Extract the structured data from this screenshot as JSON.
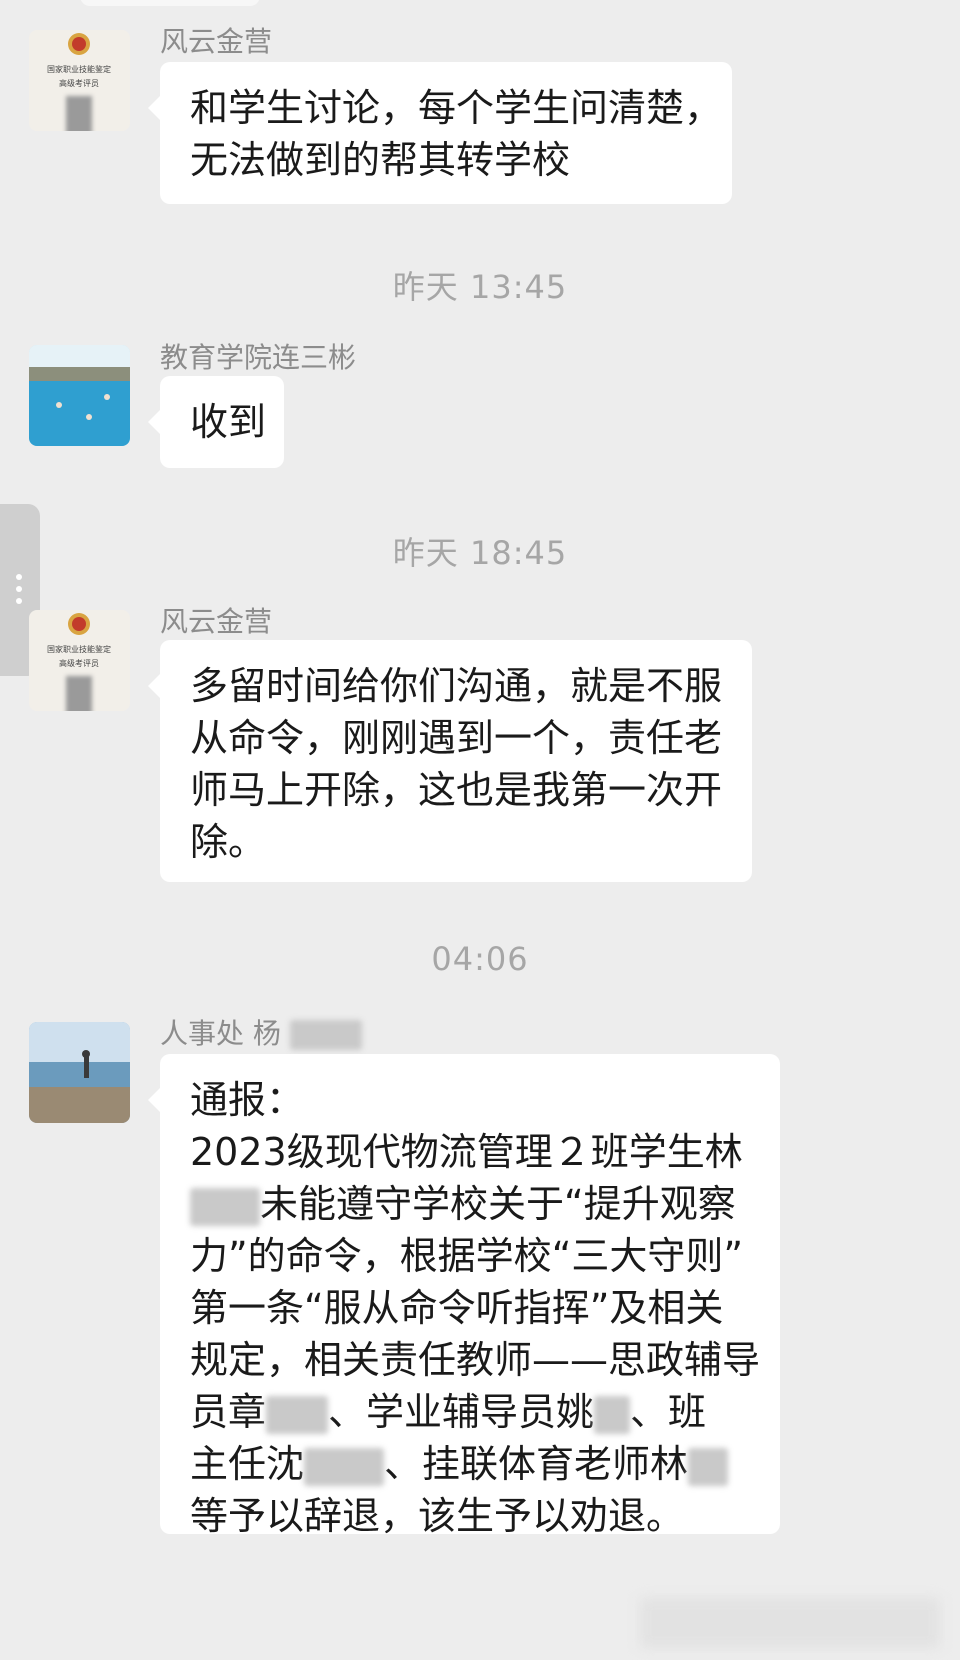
{
  "chat": {
    "timestamps": [
      "昨天 13:45",
      "昨天 18:45",
      "04:06"
    ],
    "messages": [
      {
        "sender": "风云金营",
        "avatar": "certificate-avatar",
        "lines": [
          "和学生讨论，每个学生问清楚，",
          "无法做到的帮其转学校"
        ]
      },
      {
        "sender": "教育学院连三彬",
        "avatar": "pool-avatar",
        "lines": [
          "收到"
        ]
      },
      {
        "sender": "风云金营",
        "avatar": "certificate-avatar",
        "lines": [
          "多留时间给你们沟通，就是不服",
          "从命令，刚刚遇到一个，责任老",
          "师马上开除，这也是我第一次开",
          "除。"
        ]
      },
      {
        "sender": "人事处 杨",
        "avatar": "beach-avatar",
        "lines": [
          "通报：",
          "2023级现代物流管理２班学生林",
          "未能遵守学校关于“提升观察",
          "力”的命令，根据学校“三大守则”",
          "第一条“服从命令听指挥”及相关",
          "规定，相关责任教师——思政辅导",
          "员章",
          "、学业辅导员姚",
          "、班",
          "主任沈",
          "、挂联体育老师林",
          "等予以辞退，该生予以劝退。"
        ]
      }
    ],
    "certificate_text": [
      "国家职业技能鉴定",
      "高级考评员"
    ]
  }
}
